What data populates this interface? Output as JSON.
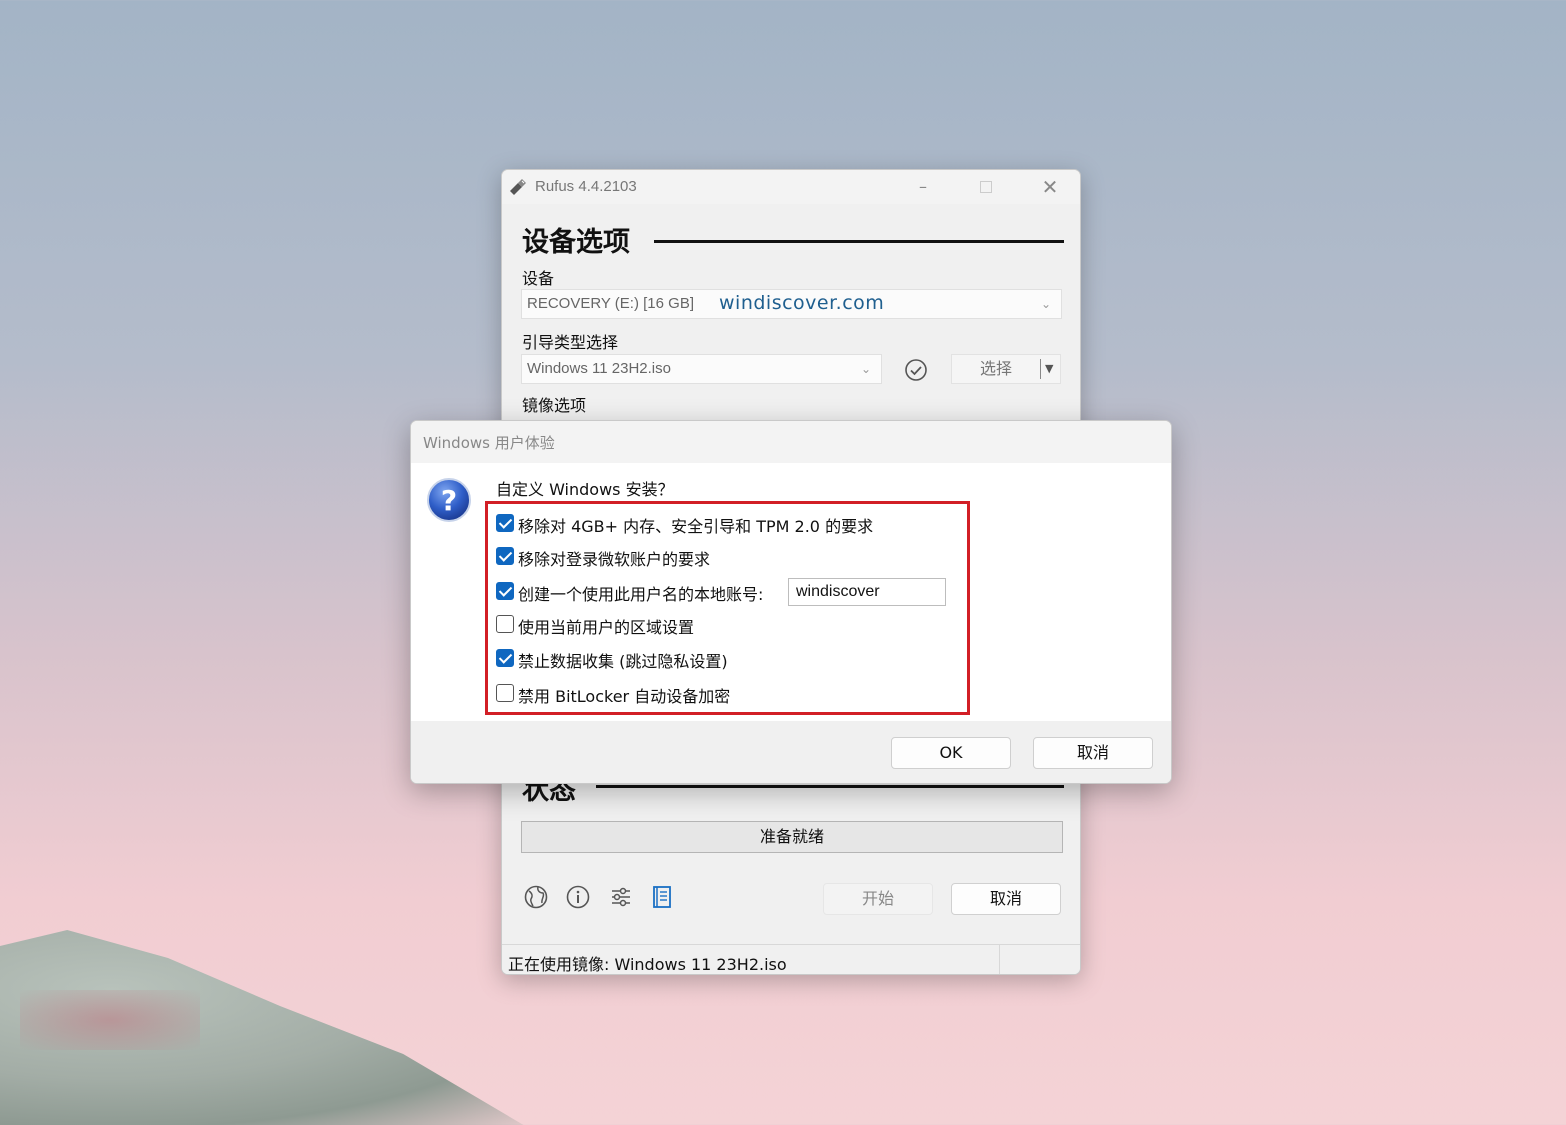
{
  "rufus": {
    "title": "Rufus 4.4.2103",
    "device_options_heading": "设备选项",
    "device_label": "设备",
    "device_value": "RECOVERY (E:) [16 GB]",
    "watermark": "windiscover.com",
    "boot_type_label": "引导类型选择",
    "boot_type_value": "Windows 11 23H2.iso",
    "select_button": "选择",
    "image_options_label": "镜像选项",
    "status_heading": "状态",
    "status_text": "准备就绪",
    "start_button": "开始",
    "cancel_button": "取消",
    "footer_text": "正在使用镜像: Windows 11 23H2.iso"
  },
  "dialog": {
    "title": "Windows 用户体验",
    "question": "自定义 Windows 安装？",
    "options": [
      {
        "label": "移除对 4GB+ 内存、安全引导和 TPM 2.0 的要求",
        "checked": true
      },
      {
        "label": "移除对登录微软账户的要求",
        "checked": true
      },
      {
        "label": "创建一个使用此用户名的本地账号:",
        "checked": true
      },
      {
        "label": "使用当前用户的区域设置",
        "checked": false
      },
      {
        "label": "禁止数据收集 (跳过隐私设置)",
        "checked": true
      },
      {
        "label": "禁用 BitLocker 自动设备加密",
        "checked": false
      }
    ],
    "username_value": "windiscover",
    "ok_button": "OK",
    "cancel_button": "取消"
  },
  "icons": [
    "rufus-usb-icon",
    "minimize-icon",
    "maximize-icon",
    "close-icon",
    "chevron-down-icon",
    "check-circle-icon",
    "split-arrow-icon",
    "globe-icon",
    "info-icon",
    "settings-sliders-icon",
    "log-icon",
    "question-icon"
  ],
  "colors": {
    "accent": "#0f67c0",
    "highlight_frame": "#d21f26",
    "watermark": "#1f5f8f"
  }
}
